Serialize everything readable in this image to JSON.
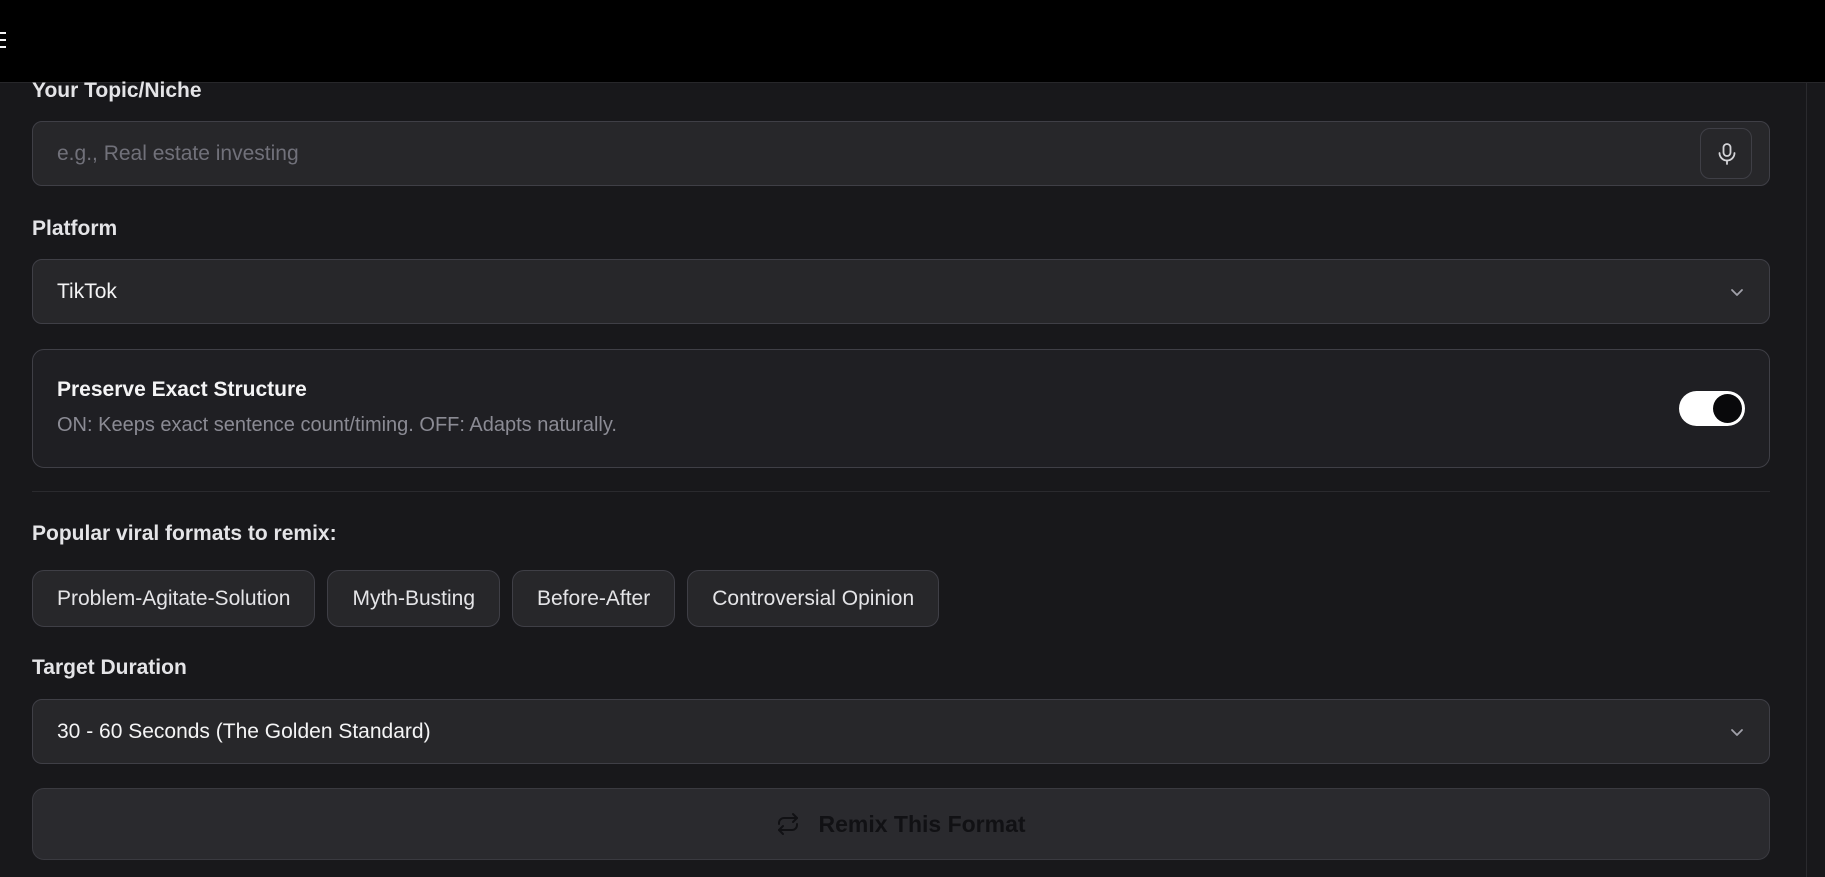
{
  "form": {
    "topic": {
      "label": "Your Topic/Niche",
      "placeholder": "e.g., Real estate investing",
      "value": ""
    },
    "platform": {
      "label": "Platform",
      "selected": "TikTok"
    },
    "preserve_structure": {
      "title": "Preserve Exact Structure",
      "description": "ON: Keeps exact sentence count/timing. OFF: Adapts naturally.",
      "enabled": true
    },
    "formats": {
      "label": "Popular viral formats to remix:",
      "chips": [
        {
          "label": "Problem-Agitate-Solution"
        },
        {
          "label": "Myth-Busting"
        },
        {
          "label": "Before-After"
        },
        {
          "label": "Controversial Opinion"
        }
      ]
    },
    "duration": {
      "label": "Target Duration",
      "selected": "30 - 60 Seconds (The Golden Standard)"
    },
    "submit": {
      "label": "Remix This Format",
      "enabled": false
    }
  },
  "icons": {
    "menu": "hamburger-icon",
    "mic": "microphone-icon",
    "chevron": "chevron-down-icon",
    "remix": "repeat-icon"
  },
  "colors": {
    "background": "#18181b",
    "topbar": "#000000",
    "field": "#27272a",
    "border": "#3f3f46",
    "toggle_on": "#ffffff"
  }
}
